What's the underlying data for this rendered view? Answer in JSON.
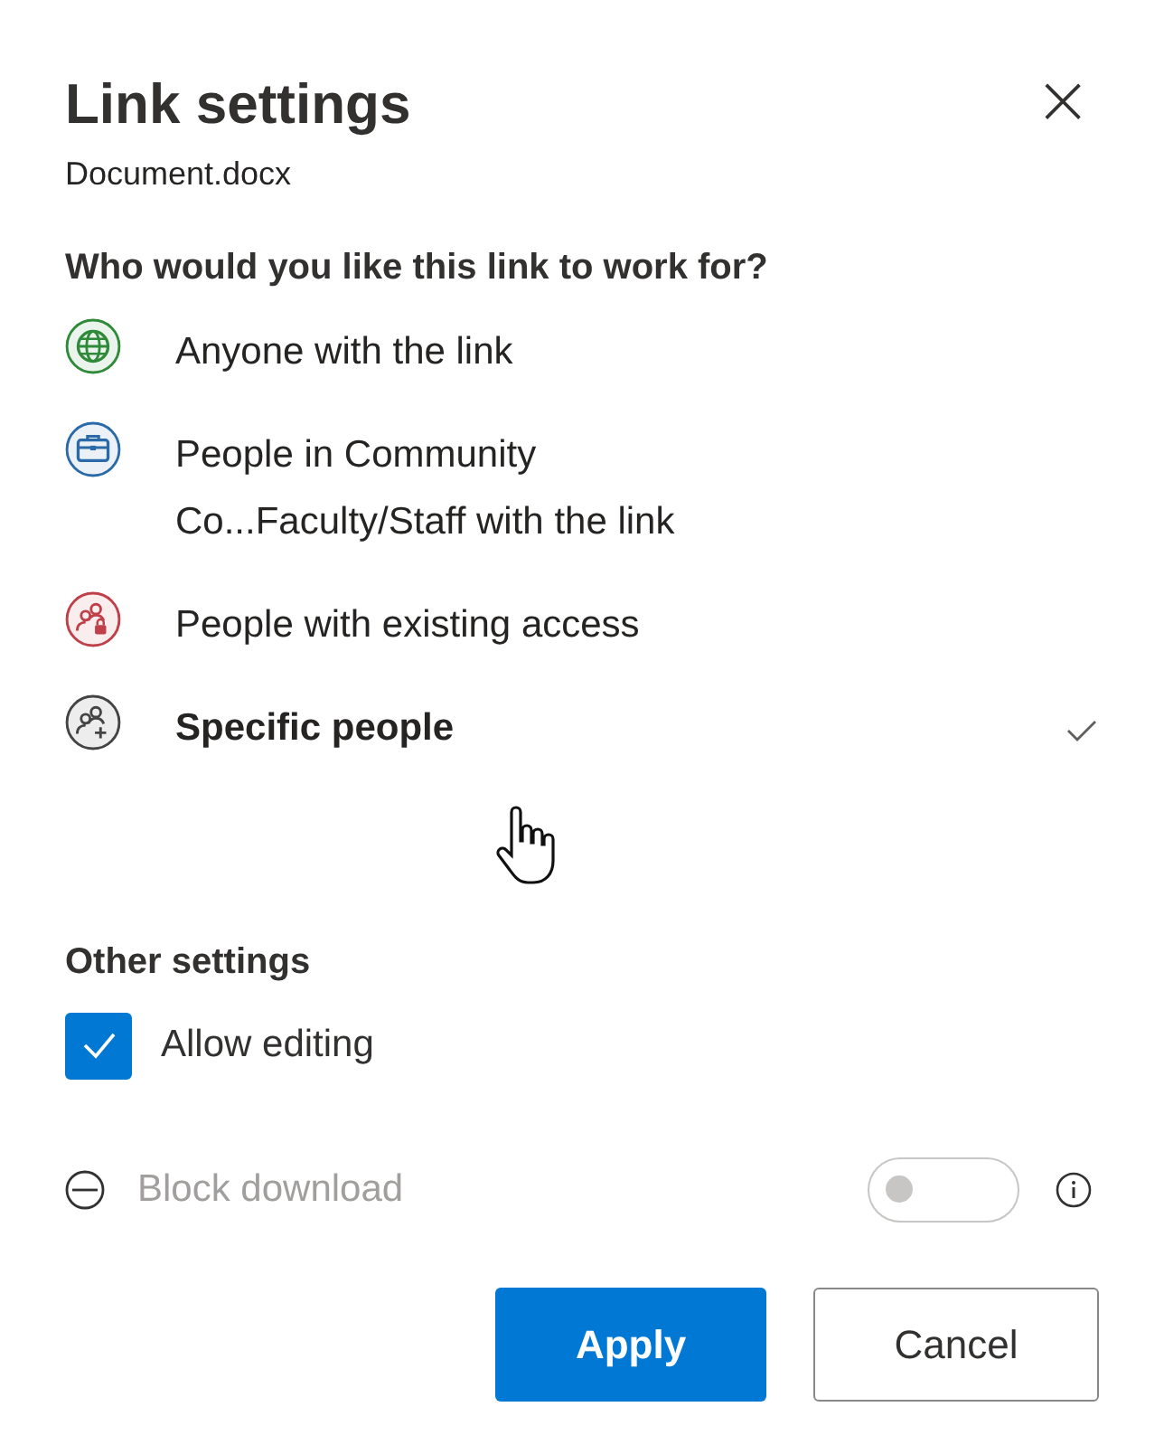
{
  "dialog": {
    "title": "Link settings",
    "subtitle": "Document.docx",
    "close": "×"
  },
  "audience": {
    "heading": "Who would you like this link to work for?",
    "options": [
      {
        "kind": "globe",
        "color": "#2f8a3a",
        "lines": [
          "Anyone with the link"
        ],
        "selected": false
      },
      {
        "kind": "briefcase",
        "color": "#2b6aa8",
        "lines": [
          "People in Community",
          "Co...Faculty/Staff with the link"
        ],
        "selected": false
      },
      {
        "kind": "people-lock",
        "color": "#c0404a",
        "lines": [
          "People with existing access"
        ],
        "selected": false
      },
      {
        "kind": "people-add",
        "color": "#444444",
        "lines": [
          "Specific people"
        ],
        "selected": true
      }
    ]
  },
  "other_settings": {
    "heading": "Other settings",
    "items": [
      {
        "kind": "checkbox",
        "label": "Allow editing",
        "checked": true,
        "disabled": false
      },
      {
        "kind": "toggle",
        "label": "Block download",
        "on": false,
        "disabled": true
      }
    ]
  },
  "buttons": [
    {
      "label": "Apply",
      "primary": true
    },
    {
      "label": "Cancel",
      "primary": false
    }
  ]
}
